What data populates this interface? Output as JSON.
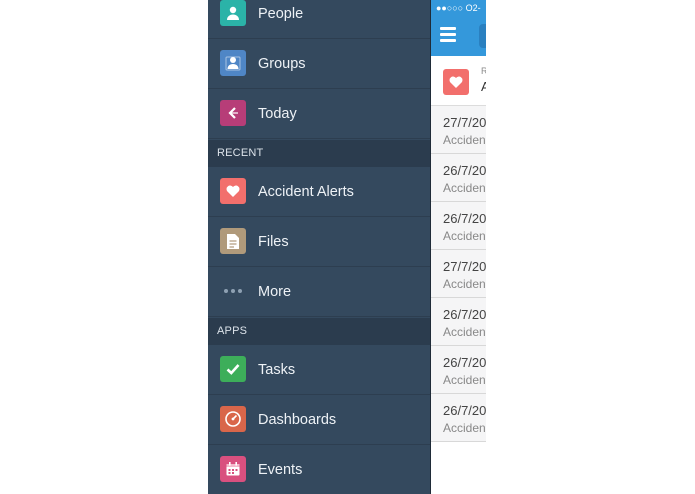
{
  "sidebar": {
    "items": [
      {
        "label": "People",
        "icon": "person-icon",
        "color": "#2bb3a8"
      },
      {
        "label": "Groups",
        "icon": "group-icon",
        "color": "#4f86c6"
      },
      {
        "label": "Today",
        "icon": "today-icon",
        "color": "#b73d78"
      }
    ],
    "recent_header": "RECENT",
    "recent_items": [
      {
        "label": "Accident Alerts",
        "icon": "heart-icon",
        "color": "#f26f6c"
      },
      {
        "label": "Files",
        "icon": "file-icon",
        "color": "#b09a7b"
      },
      {
        "label": "More",
        "icon": "more-dots-icon"
      }
    ],
    "apps_header": "APPS",
    "apps_items": [
      {
        "label": "Tasks",
        "icon": "checkmark-icon",
        "color": "#3dae5a"
      },
      {
        "label": "Dashboards",
        "icon": "gauge-icon",
        "color": "#d9664a"
      },
      {
        "label": "Events",
        "icon": "calendar-icon",
        "color": "#d9507f"
      }
    ]
  },
  "content": {
    "status_text": "●●○○○ O2-",
    "header_line1": "R",
    "header_line2": "A",
    "records": [
      {
        "date": "27/7/20",
        "subtitle": "Acciden"
      },
      {
        "date": "26/7/20",
        "subtitle": "Acciden"
      },
      {
        "date": "26/7/20",
        "subtitle": "Acciden"
      },
      {
        "date": "27/7/20",
        "subtitle": "Acciden"
      },
      {
        "date": "26/7/20",
        "subtitle": "Acciden"
      },
      {
        "date": "26/7/20",
        "subtitle": "Acciden"
      },
      {
        "date": "26/7/20",
        "subtitle": "Acciden"
      }
    ]
  }
}
